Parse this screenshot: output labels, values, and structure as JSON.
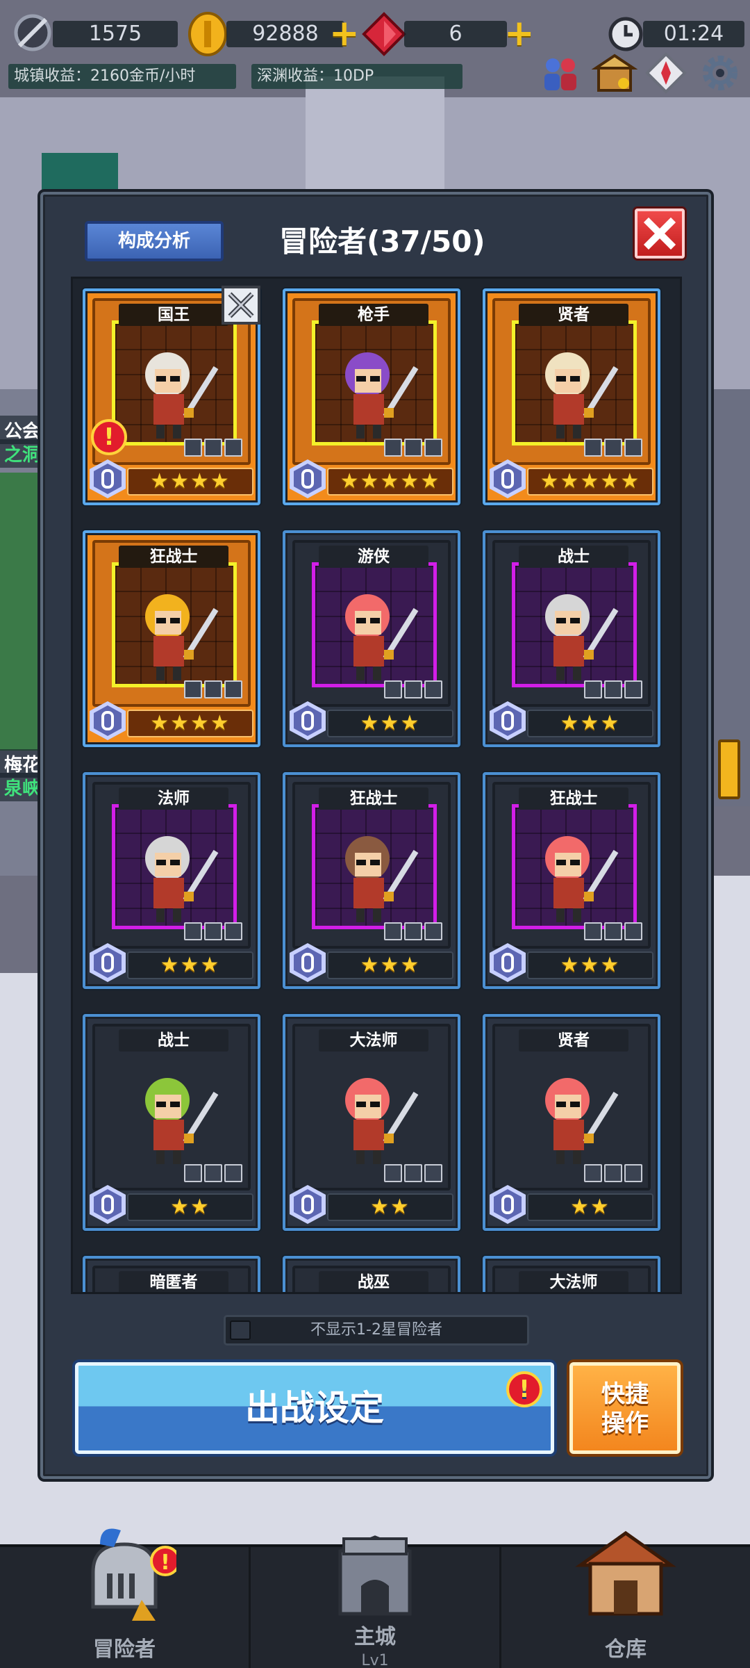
{
  "hud": {
    "gem_count": "1575",
    "gold_count": "92888",
    "ruby_count": "6",
    "timer": "01:24",
    "town_income": "城镇收益：2160金币/小时",
    "abyss_income": "深渊收益：10DP"
  },
  "background": {
    "side_label_1": "公会",
    "side_label_2": "之洞",
    "side_label_3": "梅花",
    "side_label_4": "泉峡"
  },
  "panel": {
    "analysis_label": "构成分析",
    "title": "冒险者(37/50)",
    "filter_label": "不显示1-2星冒险者",
    "deploy_label": "出战设定",
    "quick_label_line1": "快捷",
    "quick_label_line2": "操作"
  },
  "cards": [
    {
      "name": "国王",
      "stars": "★★★★",
      "tier": "gold",
      "frame": "yellow",
      "alert": true,
      "deployed": true
    },
    {
      "name": "枪手",
      "stars": "★★★★★",
      "tier": "gold",
      "frame": "yellow"
    },
    {
      "name": "贤者",
      "stars": "★★★★★",
      "tier": "gold",
      "frame": "yellow"
    },
    {
      "name": "狂战士",
      "stars": "★★★★",
      "tier": "gold",
      "frame": "yellow"
    },
    {
      "name": "游侠",
      "stars": "★★★",
      "tier": "normal",
      "frame": "purple"
    },
    {
      "name": "战士",
      "stars": "★★★",
      "tier": "normal",
      "frame": "purple"
    },
    {
      "name": "法师",
      "stars": "★★★",
      "tier": "normal",
      "frame": "purple"
    },
    {
      "name": "狂战士",
      "stars": "★★★",
      "tier": "normal",
      "frame": "purple"
    },
    {
      "name": "狂战士",
      "stars": "★★★",
      "tier": "normal",
      "frame": "purple"
    },
    {
      "name": "战士",
      "stars": "★★",
      "tier": "normal",
      "frame": "none"
    },
    {
      "name": "大法师",
      "stars": "★★",
      "tier": "normal",
      "frame": "none"
    },
    {
      "name": "贤者",
      "stars": "★★",
      "tier": "normal",
      "frame": "none"
    },
    {
      "name": "暗匿者",
      "stars": "",
      "tier": "normal",
      "frame": "none"
    },
    {
      "name": "战巫",
      "stars": "",
      "tier": "normal",
      "frame": "none"
    },
    {
      "name": "大法师",
      "stars": "",
      "tier": "normal",
      "frame": "none"
    }
  ],
  "nav": {
    "adventurers": "冒险者",
    "main_city": "主城",
    "main_city_level": "Lv1",
    "warehouse": "仓库"
  },
  "colors": {
    "panel_bg": "#2e3746",
    "card_border": "#4b90d3",
    "gold_card": "#f28b1c",
    "deploy_blue": "#3a78c8",
    "quick_orange": "#f3861e",
    "alert_red": "#e21c2c",
    "star_yellow": "#ffce2e"
  },
  "icons": [
    "gem-icon",
    "gold-coin-icon",
    "ruby-icon",
    "plus-icon",
    "clock-icon",
    "adventurer-group-icon",
    "shop-icon",
    "compass-icon",
    "gear-icon",
    "close-icon",
    "swords-icon",
    "alert-icon",
    "knight-helmet-icon",
    "castle-icon",
    "warehouse-icon"
  ]
}
